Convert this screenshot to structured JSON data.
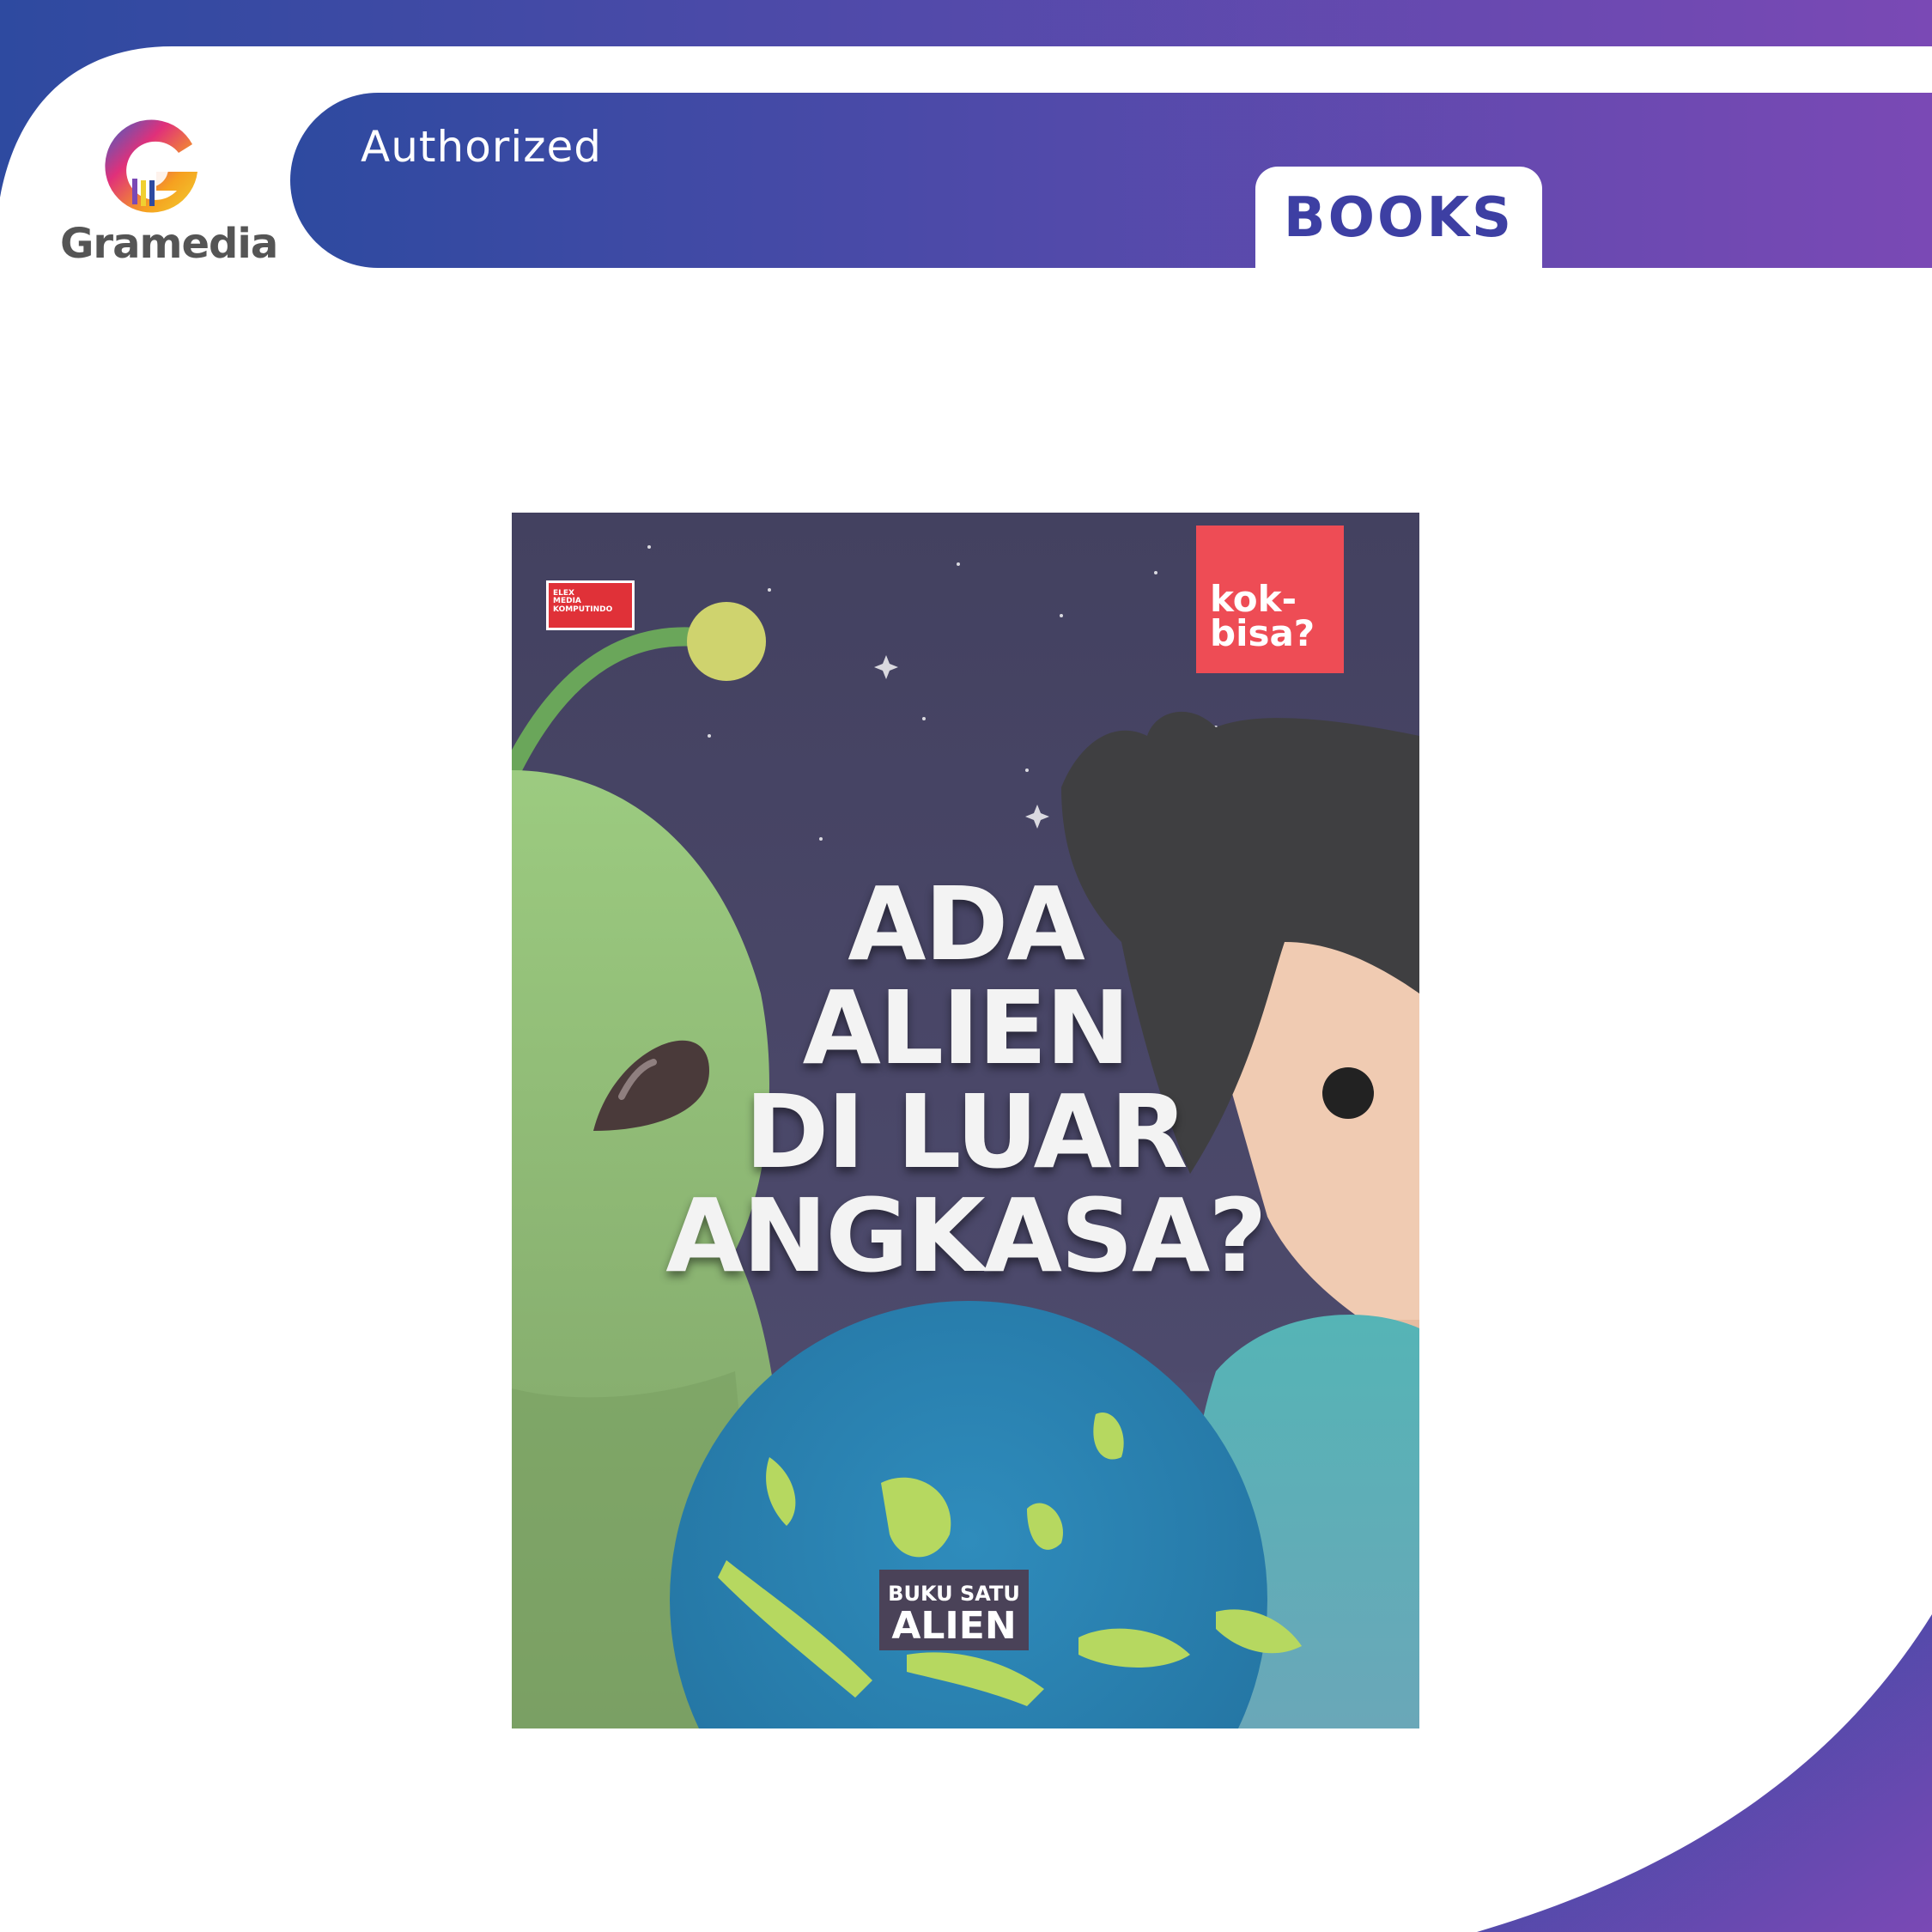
{
  "header": {
    "authorized_label": "Authorized",
    "category_tab": "BOOKS"
  },
  "brand": {
    "logo_letter": "G",
    "name": "Gramedia"
  },
  "book_cover": {
    "title_lines": [
      "ADA",
      "ALIEN",
      "DI LUAR",
      "ANGKASA?"
    ],
    "publisher_lines": [
      "ELEX",
      "MEDIA",
      "KOMPUTINDO"
    ],
    "imprint_lines": [
      "kok-",
      "bisa?"
    ],
    "series_label": "BUKU SATU",
    "series_name": "ALIEN"
  },
  "colors": {
    "banner_start": "#2e4aa0",
    "banner_end": "#7a49b5",
    "tab_text": "#3d3fa3",
    "imprint_red": "#ee4c55",
    "sky": "#474563"
  }
}
